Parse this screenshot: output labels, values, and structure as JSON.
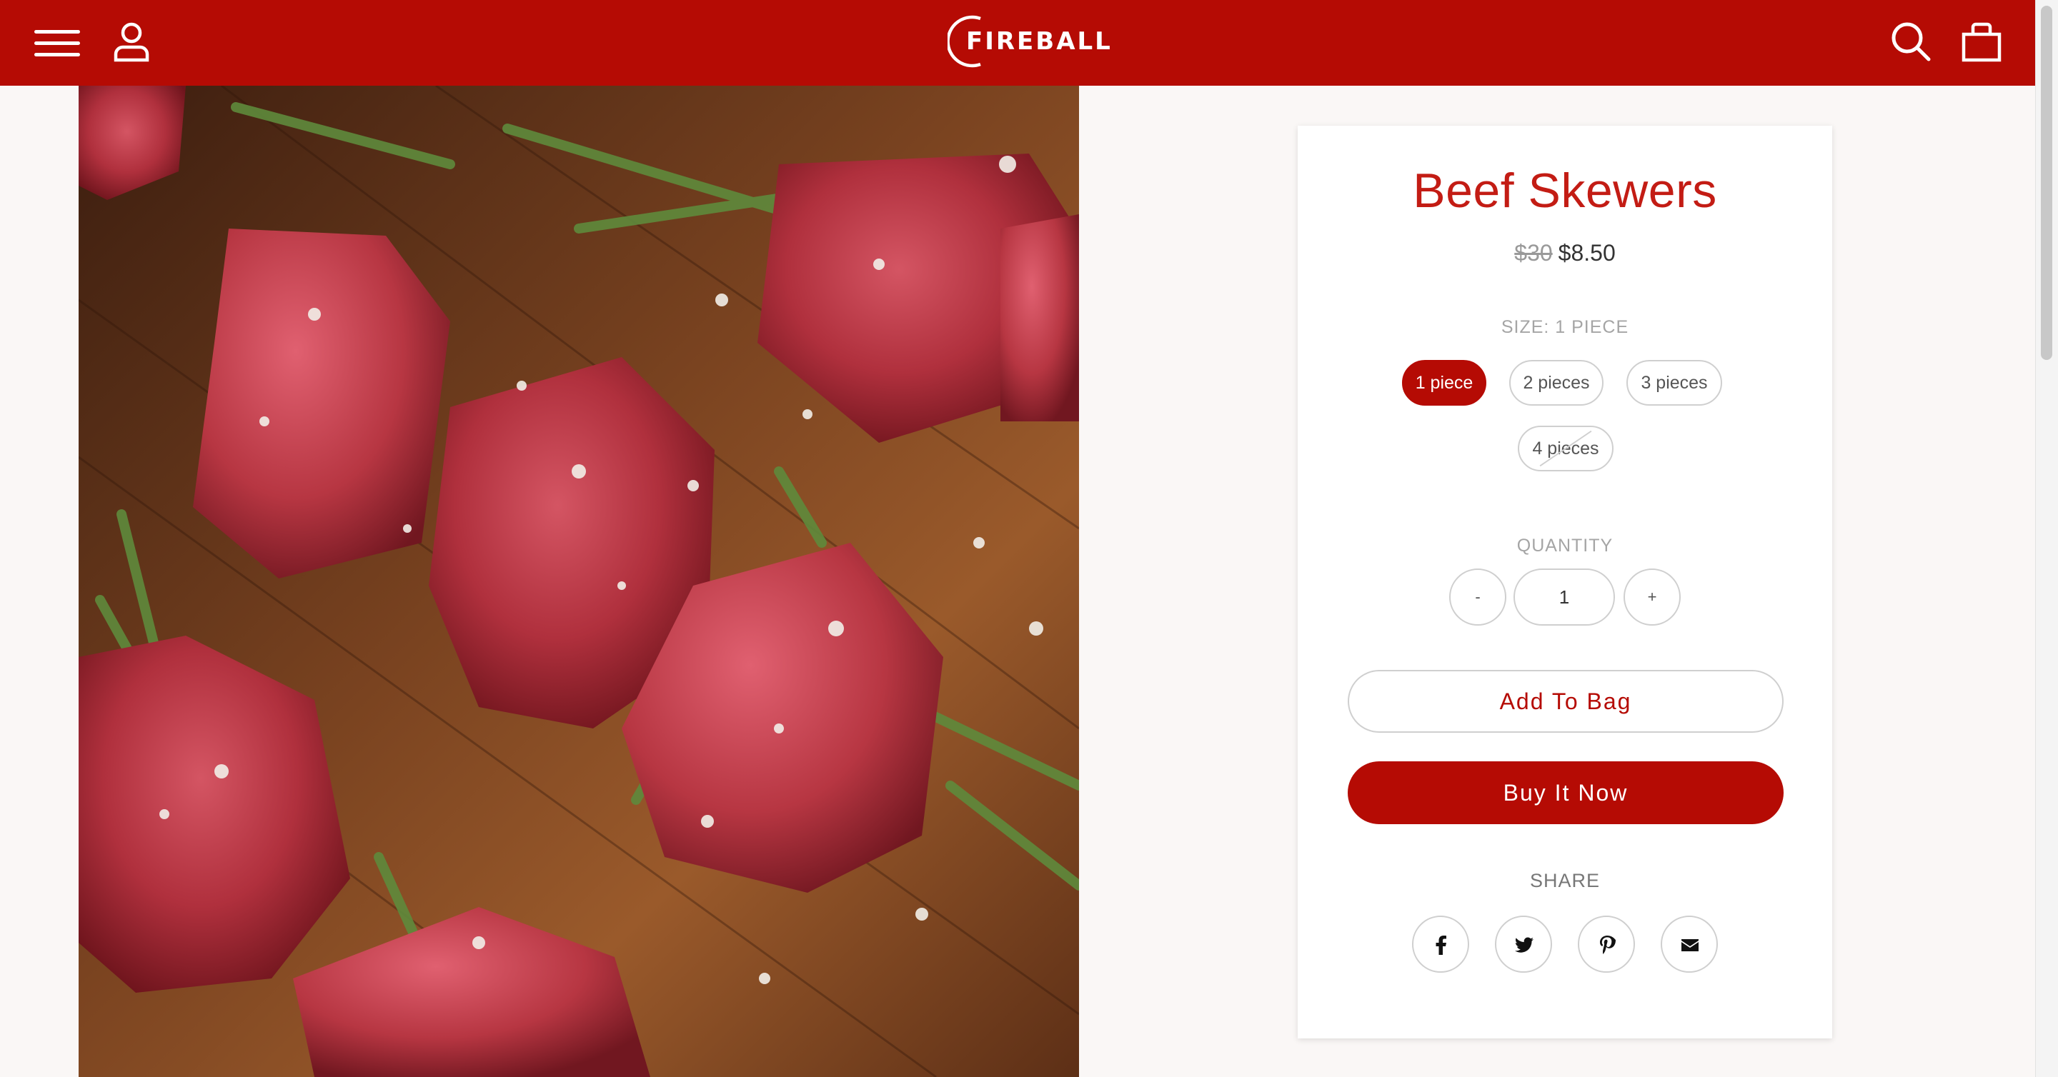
{
  "header": {
    "brand": "FIREBALL",
    "menu_icon": "hamburger-menu-icon",
    "account_icon": "user-account-icon",
    "search_icon": "search-icon",
    "cart_icon": "shopping-bag-icon",
    "color": "#b50b04"
  },
  "product": {
    "title": "Beef Skewers",
    "original_price": "$30",
    "price": "$8.50",
    "size_label": "SIZE: 1 PIECE",
    "sizes": [
      {
        "label": "1 piece",
        "selected": true,
        "available": true
      },
      {
        "label": "2 pieces",
        "selected": false,
        "available": true
      },
      {
        "label": "3 pieces",
        "selected": false,
        "available": true
      },
      {
        "label": "4 pieces",
        "selected": false,
        "available": false
      }
    ],
    "quantity_label": "QUANTITY",
    "quantity": "1",
    "decrement_label": "-",
    "increment_label": "+",
    "add_to_bag_label": "Add To Bag",
    "buy_now_label": "Buy It Now",
    "share_label": "SHARE",
    "share_icons": [
      "facebook-icon",
      "twitter-icon",
      "pinterest-icon",
      "email-icon"
    ],
    "image_description_icon": "product-photo"
  },
  "colors": {
    "brand_red": "#b50b04",
    "title_red": "#c31c14",
    "background": "#faf7f6"
  }
}
